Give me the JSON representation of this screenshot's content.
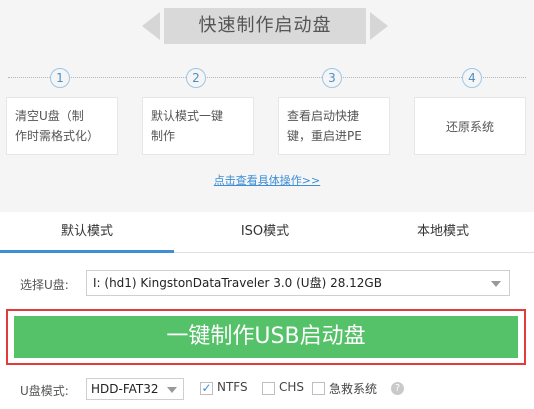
{
  "header": {
    "title": "快速制作启动盘"
  },
  "steps": [
    {
      "number": "1",
      "line1": "清空U盘（制",
      "line2": "作时需格式化）"
    },
    {
      "number": "2",
      "line1": "默认模式一键",
      "line2": "制作"
    },
    {
      "number": "3",
      "line1": "查看启动快捷",
      "line2": "键，重启进PE"
    },
    {
      "number": "4",
      "text": "还原系统"
    }
  ],
  "help_link": "点击查看具体操作>>",
  "tabs": [
    {
      "label": "默认模式",
      "active": true
    },
    {
      "label": "ISO模式",
      "active": false
    },
    {
      "label": "本地模式",
      "active": false
    }
  ],
  "usb_select": {
    "label": "选择U盘:",
    "value": "I: (hd1) KingstonDataTraveler 3.0 (U盘) 28.12GB"
  },
  "make_button": {
    "label": "一键制作USB启动盘"
  },
  "mode": {
    "label": "U盘模式:",
    "value": "HDD-FAT32",
    "options": [
      {
        "label": "NTFS",
        "checked": true
      },
      {
        "label": "CHS",
        "checked": false
      },
      {
        "label": "急救系统",
        "checked": false
      }
    ]
  },
  "colors": {
    "accent": "#3c8ed6",
    "button_green": "#55c26a",
    "highlight_red": "#e23b3b"
  }
}
